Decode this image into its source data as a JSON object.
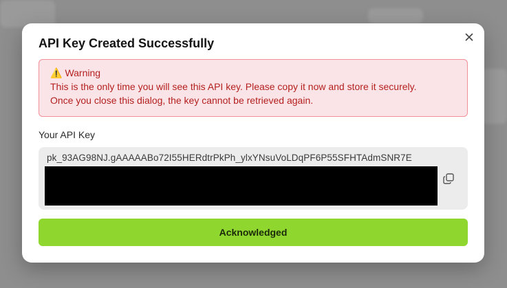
{
  "modal": {
    "title": "API Key Created Successfully",
    "close_icon": "close-icon"
  },
  "warning": {
    "icon": "warning-icon",
    "heading": "Warning",
    "line1": "This is the only time you will see this API key. Please copy it now and store it securely.",
    "line2": "Once you close this dialog, the key cannot be retrieved again."
  },
  "api_key": {
    "label": "Your API Key",
    "value": "pk_93AG98NJ.gAAAAABo72I55HERdtrPkPh_ylxYNsuVoLDqPF6P55SFHTAdmSNR7E",
    "copy_icon": "copy-icon"
  },
  "actions": {
    "acknowledge_label": "Acknowledged"
  },
  "colors": {
    "warning_text": "#b4201f",
    "warning_bg": "#fbe4e7",
    "warning_border": "#ef8f97",
    "accent": "#8fd62f"
  }
}
